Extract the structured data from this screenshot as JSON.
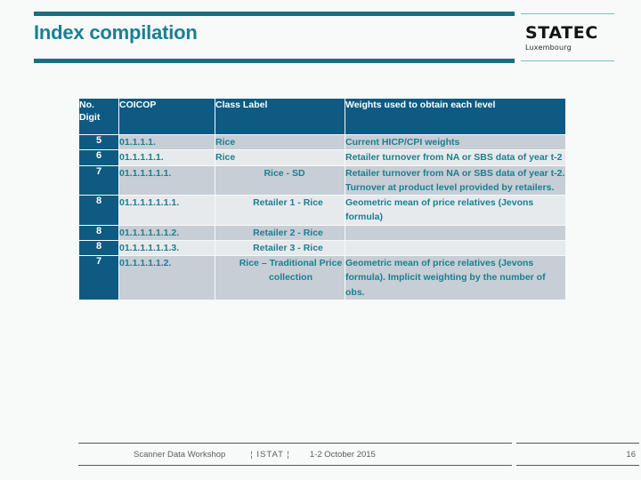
{
  "header": {
    "title": "Index compilation",
    "logo": {
      "wordmark": "STATEC",
      "subtitle": "Luxembourg"
    }
  },
  "colors": {
    "accent_teal": "#1b6e80",
    "title_teal": "#1a7f92",
    "header_blue": "#0e5a82",
    "row_light": "#e7eaec",
    "row_dark": "#c7ced5",
    "page_background": "#f8f9f9"
  },
  "table": {
    "columns": [
      {
        "key": "digit",
        "label": "No. Digit"
      },
      {
        "key": "coicop",
        "label": "COICOP"
      },
      {
        "key": "label",
        "label": "Class Label"
      },
      {
        "key": "weight",
        "label": "Weights used to obtain each level"
      }
    ],
    "header_digit_line1": "No.",
    "header_digit_line2": "Digit",
    "rows": [
      {
        "digit": "5",
        "coicop": "01.1.1.1.",
        "label": "Rice",
        "label_indent": 0,
        "weight": "Current HICP/CPI weights",
        "shade": "dark"
      },
      {
        "digit": "6",
        "coicop": "01.1.1.1.1.",
        "label": "Rice",
        "label_indent": 0,
        "weight": "Retailer turnover from NA or SBS data of year t-2",
        "shade": "light"
      },
      {
        "digit": "7",
        "coicop": "01.1.1.1.1.1.",
        "label": "Rice - SD",
        "label_indent": 1,
        "weight": "Retailer turnover from NA or SBS data of year t-2. Turnover at product level provided by retailers.",
        "shade": "dark"
      },
      {
        "digit": "8",
        "coicop": "01.1.1.1.1.1.1.",
        "label": "Retailer 1 - Rice",
        "label_indent": 2,
        "weight": "Geometric mean of price relatives (Jevons formula)",
        "shade": "light"
      },
      {
        "digit": "8",
        "coicop": "01.1.1.1.1.1.2.",
        "label": "Retailer 2 - Rice",
        "label_indent": 2,
        "weight": "",
        "shade": "dark"
      },
      {
        "digit": "8",
        "coicop": "01.1.1.1.1.1.3.",
        "label": "Retailer 3 - Rice",
        "label_indent": 2,
        "weight": "",
        "shade": "light"
      },
      {
        "digit": "7",
        "coicop": "01.1.1.1.1.2.",
        "label": "Rice – Traditional Price collection",
        "label_indent": 3,
        "weight": "Geometric mean of price relatives (Jevons formula). Implicit weighting by the number of obs.",
        "shade": "dark"
      }
    ]
  },
  "footer": {
    "event": "Scanner Data Workshop",
    "separator": "¦ ISTAT ¦",
    "date": "1-2 October 2015",
    "page_number": "16"
  }
}
